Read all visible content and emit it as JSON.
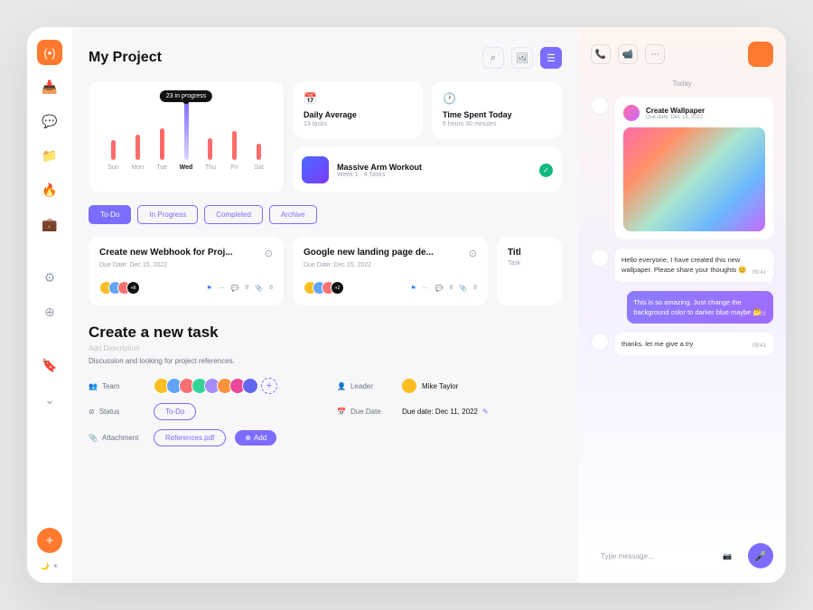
{
  "page_title": "My Project",
  "chart_data": {
    "type": "bar",
    "categories": [
      "Sun",
      "Mon",
      "Tue",
      "Wed",
      "Thu",
      "Fri",
      "Sat"
    ],
    "values": [
      22,
      28,
      35,
      65,
      24,
      32,
      18
    ],
    "tooltip": "23 in progress",
    "active_index": 3
  },
  "stats": {
    "daily": {
      "title": "Daily Average",
      "sub": "13 tasks"
    },
    "time": {
      "title": "Time Spent Today",
      "sub": "6 hours 30 minutes"
    }
  },
  "workout": {
    "title": "Massive Arm Workout",
    "sub": "Week 1  ·  4 Tasks"
  },
  "tabs": [
    "To-Do",
    "In Progress",
    "Completed",
    "Archive"
  ],
  "tasks": [
    {
      "title": "Create new Webhook for Proj...",
      "due": "Due Date: Dec 15, 2022",
      "more": "+8",
      "comments": "8",
      "attach": "8"
    },
    {
      "title": "Google new landing page de...",
      "due": "Due Date: Dec 15, 2022",
      "more": "+2",
      "comments": "8",
      "attach": "8"
    },
    {
      "title": "Titl",
      "due": "Task"
    }
  ],
  "create": {
    "title": "Create a new task",
    "desc_placeholder": "Add Description",
    "text": "Discussion and looking for project references.",
    "team_label": "Team",
    "leader_label": "Leader",
    "leader_name": "Mike Taylor",
    "status_label": "Status",
    "status_value": "To-Do",
    "duedate_label": "Due Date",
    "duedate_value": "Due date: Dec 11, 2022",
    "attachment_label": "Attachment",
    "attachment_file": "References.pdf",
    "add_btn": "Add"
  },
  "chat": {
    "date": "Today",
    "card": {
      "title": "Create Wallpaper",
      "due": "Due date: Dec 14, 2022"
    },
    "msg1": {
      "text": "Hello everyone, I have created this new wallpaper. Please share your thoughts 😊",
      "time": "09:41"
    },
    "msg2": {
      "text": "This is so amazing. Just change the background color to darker blue maybe 🤔",
      "time": "10:01"
    },
    "msg3": {
      "text": "thanks. let me give a try",
      "time": "09:41"
    },
    "placeholder": "Type message..."
  },
  "colors": {
    "purple": "#7c6cff",
    "orange": "#ff7a2e",
    "red": "#ff6b6b"
  }
}
